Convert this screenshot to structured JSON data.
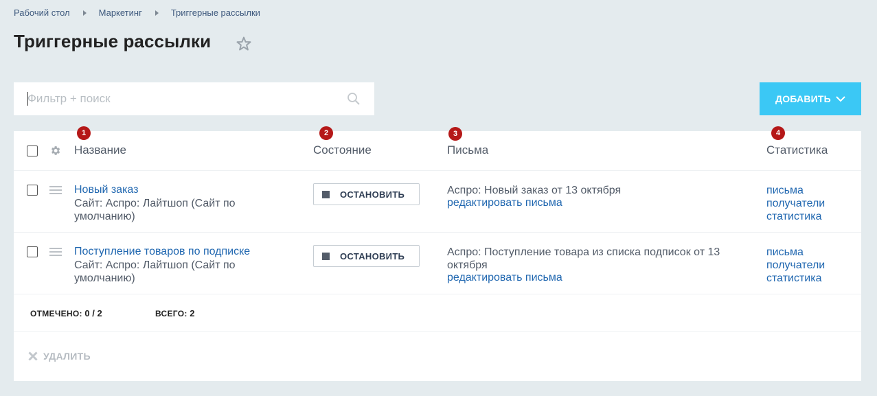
{
  "breadcrumb": [
    "Рабочий стол",
    "Маркетинг",
    "Триггерные рассылки"
  ],
  "page_title": "Триггерные рассылки",
  "search": {
    "placeholder": "Фильтр + поиск",
    "value": ""
  },
  "add_button": "ДОБАВИТЬ",
  "columns": [
    {
      "label": "Название",
      "badge": "1"
    },
    {
      "label": "Состояние",
      "badge": "2"
    },
    {
      "label": "Письма",
      "badge": "3"
    },
    {
      "label": "Статистика",
      "badge": "4"
    }
  ],
  "rows": [
    {
      "name": "Новый заказ",
      "site": "Сайт: Аспро: Лайтшоп (Сайт по умолчанию)",
      "state_button": "ОСТАНОВИТЬ",
      "letter": "Аспро: Новый заказ от 13 октября",
      "edit_letters": "редактировать письма",
      "stats": [
        "письма",
        "получатели",
        "статистика"
      ]
    },
    {
      "name": "Поступление товаров по подписке",
      "site": "Сайт: Аспро: Лайтшоп (Сайт по умолчанию)",
      "state_button": "ОСТАНОВИТЬ",
      "letter": "Аспро: Поступление товара из списка подписок от 13 октября",
      "edit_letters": "редактировать письма",
      "stats": [
        "письма",
        "получатели",
        "статистика"
      ]
    }
  ],
  "footer": {
    "selected_label": "ОТМЕЧЕНО:",
    "selected_value": "0 / 2",
    "total_label": "ВСЕГО:",
    "total_value": "2",
    "delete_label": "УДАЛИТЬ"
  },
  "colors": {
    "accent": "#3bc8f5",
    "link": "#2067b0",
    "badge": "#b51818",
    "background": "#e4ebee"
  }
}
